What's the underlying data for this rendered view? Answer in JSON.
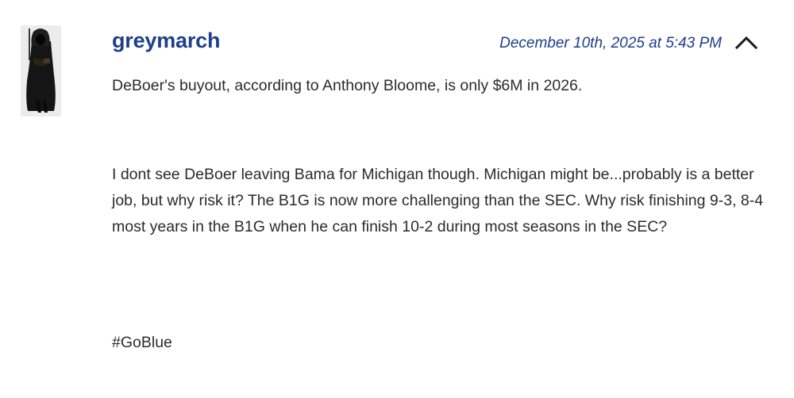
{
  "comment": {
    "author": "greymarch",
    "timestamp": "December 10th, 2025 at 5:43 PM",
    "collapse_icon": "chevron-up-icon",
    "paragraphs": [
      "DeBoer's buyout, according to Anthony Bloome, is only $6M in 2026.",
      "I dont see DeBoer leaving Bama for Michigan though.  Michigan might be...probably is a better job, but why risk it?  The B1G is now more challenging than the SEC.  Why risk finishing 9-3, 8-4 most years in the B1G when he can finish 10-2 during most seasons in the SEC?",
      "#GoBlue"
    ]
  },
  "colors": {
    "link": "#1d3f8c",
    "text": "#2b2b2b"
  }
}
